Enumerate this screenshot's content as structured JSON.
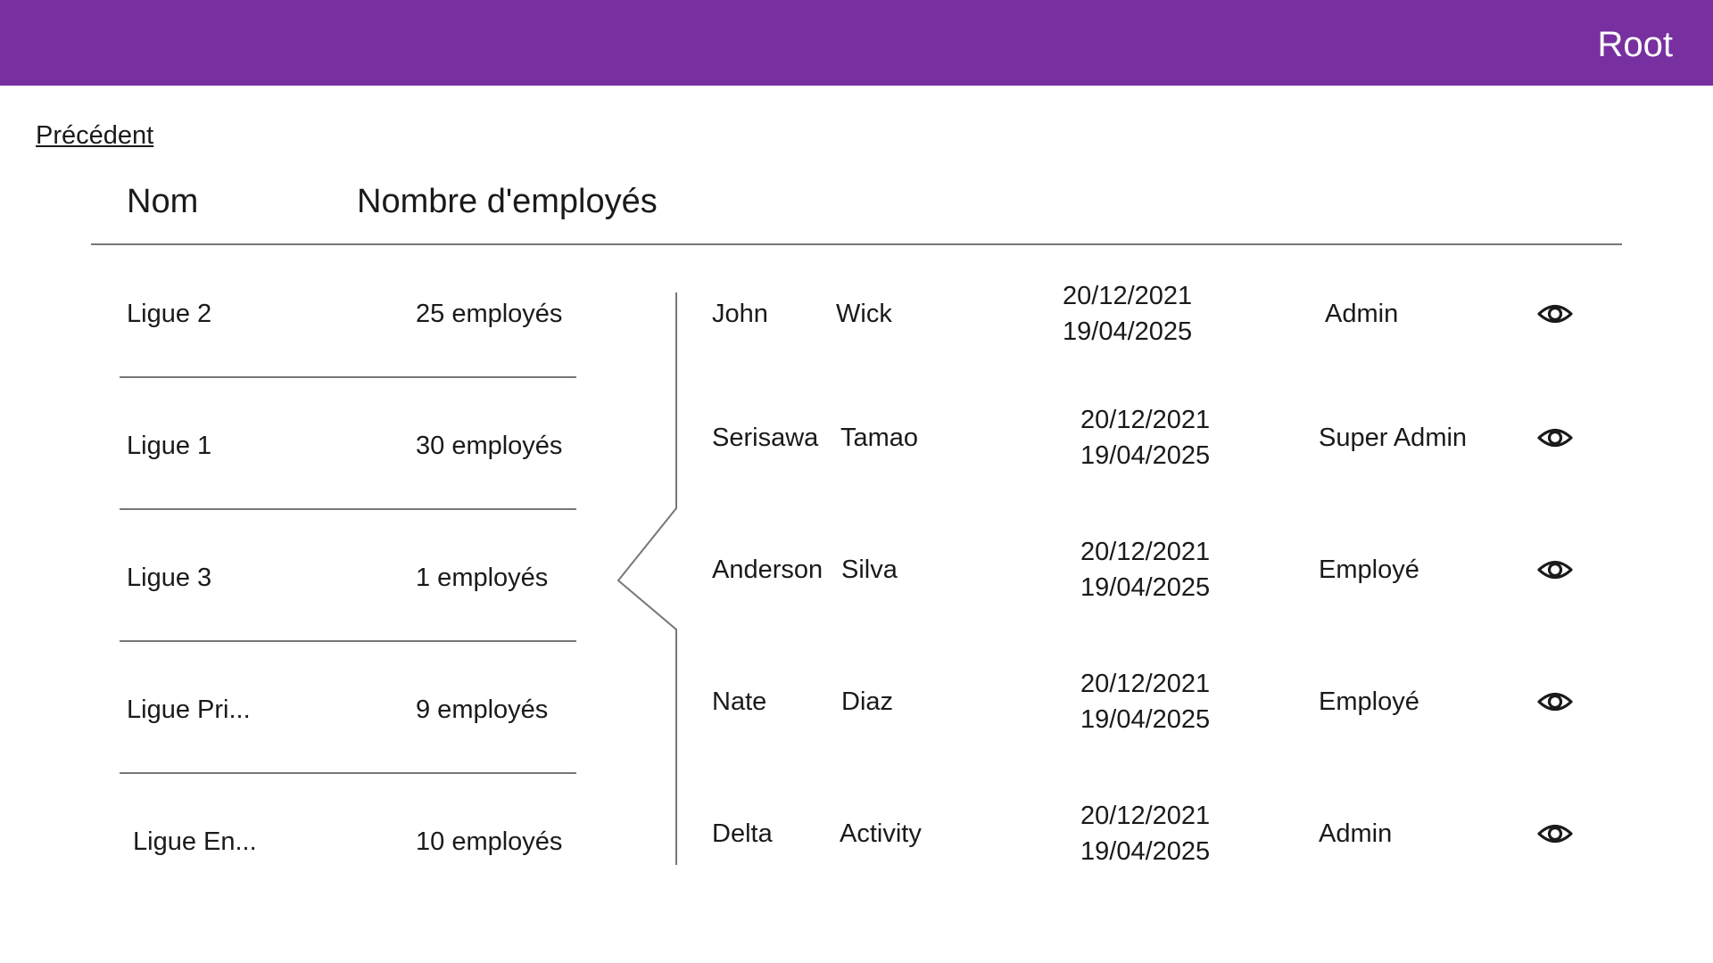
{
  "header": {
    "user_label": "Root"
  },
  "nav": {
    "back_label": "Précédent"
  },
  "columns": {
    "name": "Nom",
    "employee_count": "Nombre d'employés"
  },
  "leagues": [
    {
      "name": "Ligue 2",
      "count": "25 employés"
    },
    {
      "name": "Ligue 1",
      "count": "30 employés"
    },
    {
      "name": "Ligue 3",
      "count": "1 employés",
      "selected": true
    },
    {
      "name": "Ligue Pri...",
      "count": "9 employés"
    },
    {
      "name": "Ligue En...",
      "count": "10 employés"
    }
  ],
  "employees": [
    {
      "first_name": "John",
      "last_name": "Wick",
      "start_date": "20/12/2021",
      "end_date": "19/04/2025",
      "role": "Admin",
      "action_icon": "eye-icon"
    },
    {
      "first_name": "Serisawa",
      "last_name": "Tamao",
      "start_date": "20/12/2021",
      "end_date": "19/04/2025",
      "role": "Super Admin",
      "action_icon": "eye-icon"
    },
    {
      "first_name": "Anderson",
      "last_name": "Silva",
      "start_date": "20/12/2021",
      "end_date": "19/04/2025",
      "role": "Employé",
      "action_icon": "eye-icon"
    },
    {
      "first_name": "Nate",
      "last_name": "Diaz",
      "start_date": "20/12/2021",
      "end_date": "19/04/2025",
      "role": "Employé",
      "action_icon": "eye-icon"
    },
    {
      "first_name": "Delta",
      "last_name": "Activity",
      "start_date": "20/12/2021",
      "end_date": "19/04/2025",
      "role": "Admin",
      "action_icon": "eye-icon"
    }
  ],
  "colors": {
    "header_bg": "#7830a0",
    "header_text": "#ffffff",
    "rule": "#777777"
  }
}
